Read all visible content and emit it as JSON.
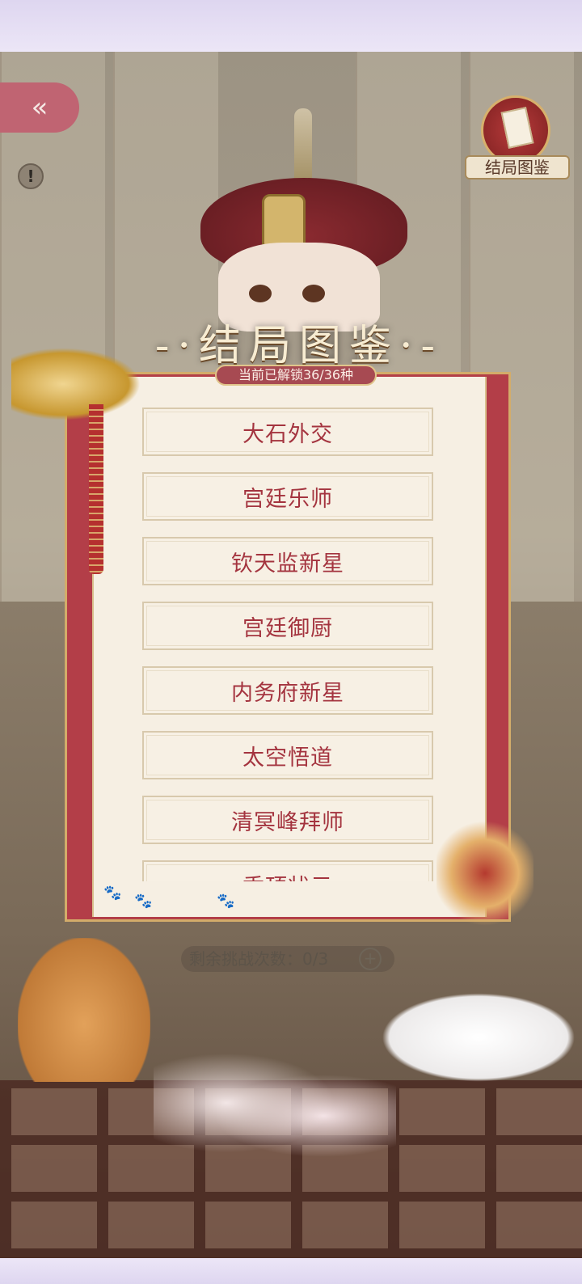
{
  "header": {
    "back_icon": "double-chevron-left-icon",
    "warning_icon": "exclamation-icon"
  },
  "ending_book_button": {
    "label": "结局图鉴",
    "icon": "scroll-book-icon"
  },
  "dialog": {
    "title": "-·结局图鉴·-",
    "unlock_status": "当前已解锁36/36种",
    "endings": [
      "大石外交",
      "宫廷乐师",
      "钦天监新星",
      "宫廷御厨",
      "内务府新星",
      "太空悟道",
      "清冥峰拜师",
      "秃顶状元"
    ]
  },
  "challenge": {
    "remaining_label": "剩余挑战次数：0/3",
    "add_icon": "plus-icon"
  },
  "colors": {
    "frame_red": "#b33e48",
    "paper": "#f6efe3",
    "item_text": "#a4343f",
    "gold": "#d3ac6a"
  }
}
